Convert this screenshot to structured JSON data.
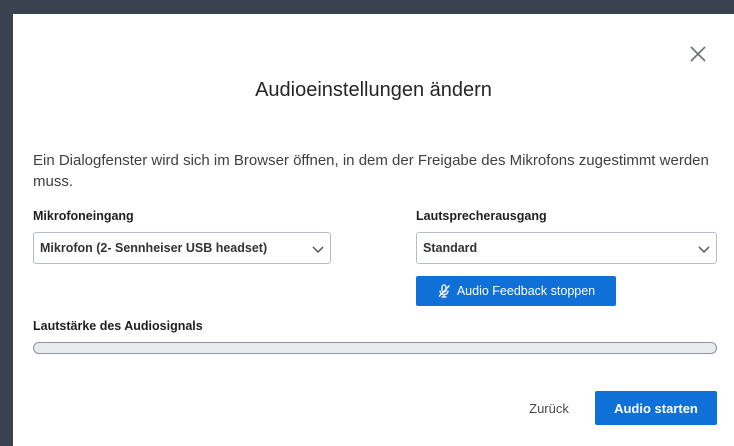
{
  "dialog": {
    "title": "Audioeinstellungen ändern",
    "info_text": "Ein Dialogfenster wird sich im Browser öffnen, in dem der Freigabe des Mikrofons zugestimmt werden muss."
  },
  "microphone": {
    "label": "Mikrofoneingang",
    "selected": "Mikrofon (2- Sennheiser USB headset)"
  },
  "speaker": {
    "label": "Lautsprecherausgang",
    "selected": "Standard"
  },
  "feedback_button": {
    "label": "Audio Feedback stoppen",
    "icon": "microphone-muted-icon"
  },
  "volume": {
    "label": "Lautstärke des Audiosignals",
    "level": 0
  },
  "footer": {
    "back_label": "Zurück",
    "start_label": "Audio starten"
  },
  "colors": {
    "primary": "#0f70d7",
    "backdrop": "#3a4250"
  }
}
